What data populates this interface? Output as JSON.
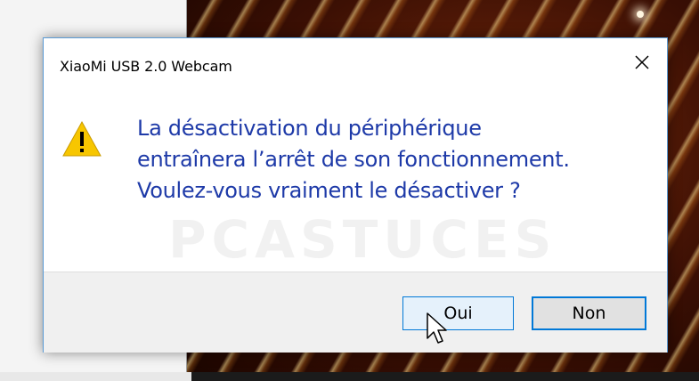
{
  "dialog": {
    "title": "XiaoMi USB 2.0 Webcam",
    "close_glyph": "✕",
    "icon": "warning-icon",
    "message_lines": [
      "La désactivation du périphérique",
      "entraînera l’arrêt de son fonctionnement.",
      "Voulez-vous vraiment le désactiver ?"
    ],
    "watermark": "PCASTUCES",
    "buttons": {
      "yes": "Oui",
      "no": "Non"
    }
  },
  "colors": {
    "message_text": "#1e3aa8",
    "accent": "#0078d7",
    "warning_yellow": "#f7c600"
  }
}
